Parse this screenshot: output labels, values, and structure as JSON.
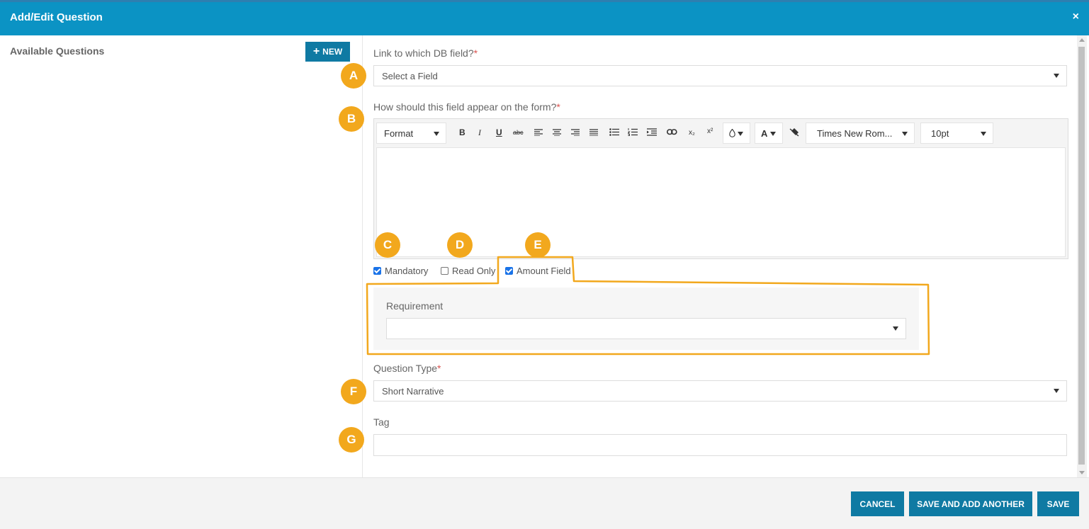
{
  "dialog": {
    "title": "Add/Edit Question",
    "close_glyph": "×"
  },
  "left_panel": {
    "heading": "Available Questions",
    "new_button": "NEW",
    "new_icon": "+"
  },
  "db_field": {
    "label": "Link to which DB field?",
    "required_mark": "*",
    "value": "Select a Field"
  },
  "appearance": {
    "label": "How should this field appear on the form?",
    "required_mark": "*"
  },
  "editor_toolbar": {
    "format": "Format",
    "font_family": "Times New Rom...",
    "font_size": "10pt",
    "text_color_label": "A",
    "icons": {
      "bold": "B",
      "italic": "I",
      "underline": "U",
      "strike": "abc",
      "subscript": "x₂",
      "superscript": "x²"
    }
  },
  "checkboxes": [
    {
      "label": "Mandatory",
      "checked": true
    },
    {
      "label": "Read Only",
      "checked": false
    },
    {
      "label": "Amount Field",
      "checked": true
    }
  ],
  "requirement": {
    "label": "Requirement",
    "value": ""
  },
  "question_type": {
    "label": "Question Type",
    "required_mark": "*",
    "value": "Short Narrative"
  },
  "tag": {
    "label": "Tag",
    "value": ""
  },
  "badges": [
    "A",
    "B",
    "C",
    "D",
    "E",
    "F",
    "G"
  ],
  "footer": {
    "cancel": "CANCEL",
    "save_add": "SAVE AND ADD ANOTHER",
    "save": "SAVE"
  },
  "colors": {
    "header": "#0b93c4",
    "button": "#0f7aa3",
    "badge": "#f2a81d",
    "required": "#d9534f"
  }
}
